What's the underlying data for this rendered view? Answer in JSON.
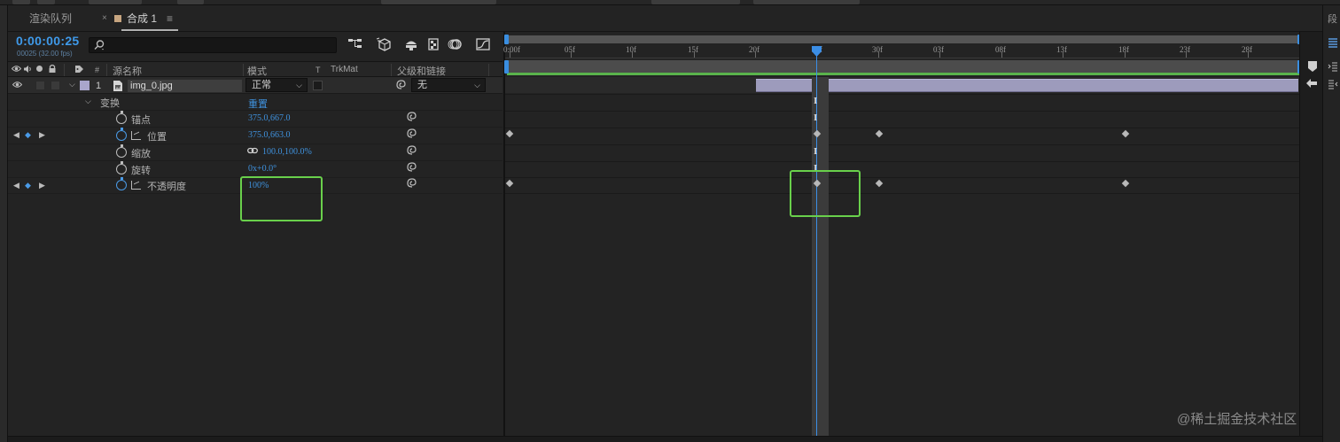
{
  "tabs": {
    "render_queue": "渲染队列",
    "comp": "合成 1",
    "close": "×",
    "menu": "≡"
  },
  "comp": {
    "timecode": "0:00:00:25",
    "fps": "00025 (32.00 fps)",
    "search_placeholder": ""
  },
  "columns": {
    "source_name": "源名称",
    "hash": "#",
    "mode": "模式",
    "t": "T",
    "trkmat": "TrkMat",
    "parent": "父级和链接"
  },
  "layer": {
    "index": "1",
    "name": "img_0.jpg",
    "mode": "正常",
    "parent": "无",
    "label_color": "#a9a6cc"
  },
  "transform": {
    "group": "变换",
    "reset": "重置",
    "properties": [
      {
        "name": "锚点",
        "value": "375.0,667.0"
      },
      {
        "name": "位置",
        "value": "375.0,663.0"
      },
      {
        "name": "缩放",
        "value": "100.0,100.0%"
      },
      {
        "name": "旋转",
        "value": "0x+0.0°"
      },
      {
        "name": "不透明度",
        "value": "100%"
      }
    ]
  },
  "ruler": {
    "ticks": [
      "0:00f",
      "05f",
      "10f",
      "15f",
      "20f",
      "25f",
      "30f",
      "03f",
      "08f",
      "13f",
      "18f",
      "23f",
      "28f"
    ]
  },
  "colors": {
    "accent": "#3f9aea",
    "highlight": "#69d04b",
    "layer_bar": "#9d9bbc"
  },
  "watermark": "@稀土掘金技术社区",
  "right_rail": {
    "top_char": "段"
  }
}
